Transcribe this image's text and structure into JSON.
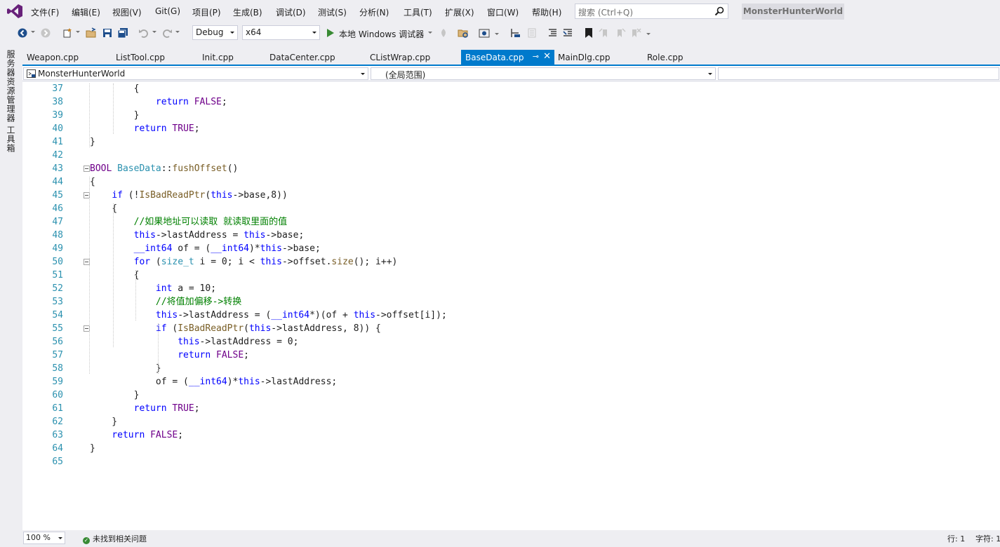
{
  "menu": {
    "items": [
      "文件(F)",
      "编辑(E)",
      "视图(V)",
      "Git(G)",
      "项目(P)",
      "生成(B)",
      "调试(D)",
      "测试(S)",
      "分析(N)",
      "工具(T)",
      "扩展(X)",
      "窗口(W)",
      "帮助(H)"
    ],
    "search_placeholder": "搜索 (Ctrl+Q)",
    "solution_title": "MonsterHunterWorld"
  },
  "toolbar": {
    "config": "Debug",
    "platform": "x64",
    "run_label": "本地 Windows 调试器"
  },
  "left_panels": [
    "服务器资源管理器",
    "工具箱"
  ],
  "tabs": [
    {
      "label": "Weapon.cpp",
      "active": false
    },
    {
      "label": "ListTool.cpp",
      "active": false
    },
    {
      "label": "Init.cpp",
      "active": false
    },
    {
      "label": "DataCenter.cpp",
      "active": false
    },
    {
      "label": "CListWrap.cpp",
      "active": false
    },
    {
      "label": "BaseData.cpp",
      "active": true
    },
    {
      "label": "MainDlg.cpp",
      "active": false
    },
    {
      "label": "Role.cpp",
      "active": false
    }
  ],
  "navigation": {
    "project": "MonsterHunterWorld",
    "scope": "(全局范围)"
  },
  "editor": {
    "line_numbers": [
      "37",
      "38",
      "39",
      "40",
      "41",
      "42",
      "43",
      "44",
      "45",
      "46",
      "47",
      "48",
      "49",
      "50",
      "51",
      "52",
      "53",
      "54",
      "55",
      "56",
      "57",
      "58",
      "59",
      "60",
      "61",
      "62",
      "63",
      "64",
      "65"
    ],
    "lines": [
      "        {",
      "            return FALSE;",
      "        }",
      "        return TRUE;",
      "}",
      "",
      "BOOL BaseData::fushOffset()",
      "{",
      "    if (!IsBadReadPtr(this->base,8))",
      "    {",
      "        //如果地址可以读取 就读取里面的值",
      "        this->lastAddress = this->base;",
      "        __int64 of = (__int64)*this->base;",
      "        for (size_t i = 0; i < this->offset.size(); i++)",
      "        {",
      "            int a = 10;",
      "            //将值加偏移->转换",
      "            this->lastAddress = (__int64*)(of + this->offset[i]);",
      "            if (IsBadReadPtr(this->lastAddress, 8)) {",
      "                this->lastAddress = 0;",
      "                return FALSE;",
      "            }",
      "            of = (__int64)*this->lastAddress;",
      "        }",
      "        return TRUE;",
      "    }",
      "    return FALSE;",
      "}",
      ""
    ]
  },
  "status": {
    "zoom": "100 %",
    "issues": "未找到相关问题",
    "line": "行: 1",
    "char": "字符: 1"
  },
  "colors": {
    "accent": "#007acc",
    "chrome": "#eeeef2",
    "keyword": "#0000ff",
    "type": "#2b91af",
    "comment": "#008000",
    "function": "#795e26",
    "macro": "#6f008a"
  }
}
